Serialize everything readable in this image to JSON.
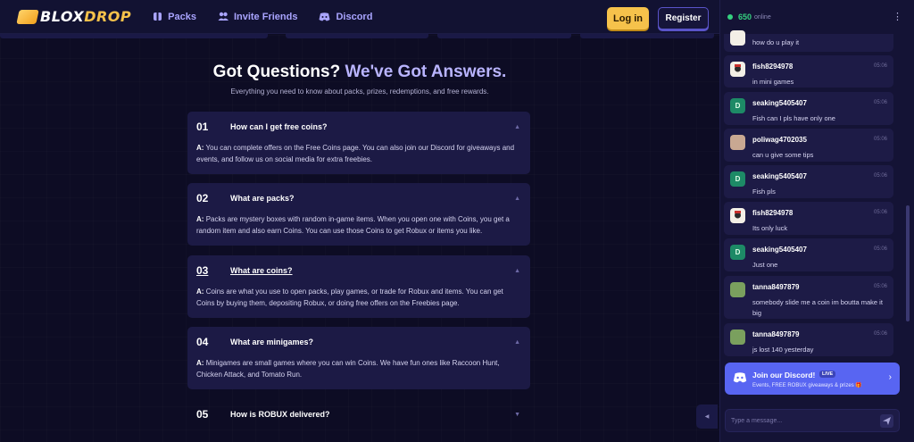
{
  "header": {
    "logo": {
      "blox": "BLOX",
      "drop": "DROP"
    },
    "nav": [
      {
        "label": "Packs",
        "icon": "packs-icon"
      },
      {
        "label": "Invite Friends",
        "icon": "invite-icon"
      },
      {
        "label": "Discord",
        "icon": "discord-icon"
      }
    ],
    "login_label": "Log in",
    "register_label": "Register"
  },
  "faq": {
    "title_main": "Got Questions?",
    "title_accent": "We've Got Answers.",
    "subtitle": "Everything you need to know about packs, prizes, redemptions, and free rewards.",
    "items": [
      {
        "num": "01",
        "question": "How can I get free coins?",
        "prefix": "A:",
        "answer": "You can complete offers on the Free Coins page. You can also join our Discord for giveaways and events, and follow us on social media for extra freebies."
      },
      {
        "num": "02",
        "question": "What are packs?",
        "prefix": "A:",
        "answer": "Packs are mystery boxes with random in-game items. When you open one with Coins, you get a random item and also earn Coins. You can use those Coins to get Robux or items you like."
      },
      {
        "num": "03",
        "question": "What are coins?",
        "prefix": "A:",
        "answer": "Coins are what you use to open packs, play games, or trade for Robux and items. You can get Coins by buying them, depositing Robux, or doing free offers on the Freebies page."
      },
      {
        "num": "04",
        "question": "What are minigames?",
        "prefix": "A:",
        "answer": "Minigames are small games where you can win Coins. We have fun ones like Raccoon Hunt, Chicken Attack, and Tomato Run."
      },
      {
        "num": "05",
        "question": "How is ROBUX delivered?"
      }
    ]
  },
  "chat": {
    "online_count": "650",
    "online_label": "online",
    "partial_message": "how do u play it",
    "messages": [
      {
        "user": "fish8294978",
        "time": "05:06",
        "text": "in mini games",
        "avatar": "fish"
      },
      {
        "user": "seaking5405407",
        "time": "05:06",
        "text": "Fish can I pls have only one",
        "avatar": "D"
      },
      {
        "user": "poliwag4702035",
        "time": "05:06",
        "text": "can u give some tips",
        "avatar": "poli"
      },
      {
        "user": "seaking5405407",
        "time": "05:06",
        "text": "Fish pls",
        "avatar": "D"
      },
      {
        "user": "fish8294978",
        "time": "05:06",
        "text": "Its only luck",
        "avatar": "fish"
      },
      {
        "user": "seaking5405407",
        "time": "05:06",
        "text": "Just one",
        "avatar": "D"
      },
      {
        "user": "tanna8497879",
        "time": "05:06",
        "text": "somebody slide me a coin im boutta make it big",
        "avatar": "tanna"
      },
      {
        "user": "tanna8497879",
        "time": "05:06",
        "text": "js lost 140 yesterday",
        "avatar": "tanna"
      }
    ],
    "discord_title": "Join our Discord!",
    "discord_live": "LIVE",
    "discord_sub": "Events, FREE ROBUX giveaways & prizes 🎁",
    "input_placeholder": "Type a message..."
  },
  "colors": {
    "accent": "#b9b4ff",
    "gold": "#f6c24b",
    "discord": "#5865f2",
    "online": "#35d07f"
  }
}
